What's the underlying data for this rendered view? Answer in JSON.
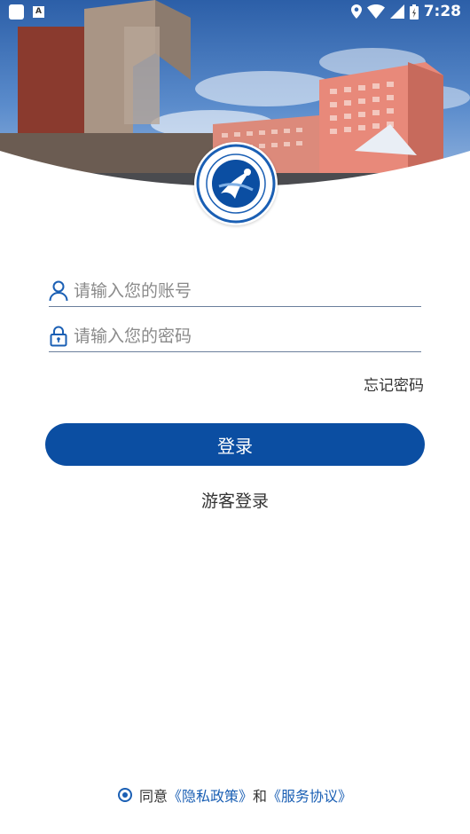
{
  "status_bar": {
    "time": "7:28",
    "notification_icon": "A"
  },
  "logo": {
    "icon": "school-emblem",
    "colors": {
      "ring": "#1a5fb4",
      "accent": "#0b4ea2"
    }
  },
  "login": {
    "account_placeholder": "请输入您的账号",
    "password_placeholder": "请输入您的密码",
    "forgot_password": "忘记密码",
    "login_button": "登录",
    "guest_login": "游客登录"
  },
  "agreement": {
    "prefix": "同意",
    "privacy_link": "《隐私政策》",
    "and": "和",
    "service_link": "《服务协议》"
  },
  "colors": {
    "primary": "#0b4ea2",
    "link": "#1a5fb4"
  }
}
